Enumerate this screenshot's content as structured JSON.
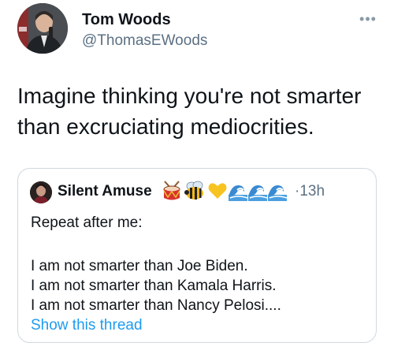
{
  "tweet": {
    "author": {
      "name": "Tom Woods",
      "handle": "@ThomasEWoods",
      "avatar_icon": "profile-photo"
    },
    "text": "Imagine thinking you're not smarter than excruciating mediocrities.",
    "more_icon": "ellipsis-icon",
    "quoted_tweet": {
      "author_name": "Silent Amuse",
      "author_emojis": [
        "drum",
        "bee",
        "yellow-heart",
        "wave",
        "wave",
        "wave"
      ],
      "separator": "·",
      "time": "13h",
      "body_lines": [
        "Repeat after me:",
        "I am not smarter than Joe Biden.",
        "I am not smarter than Kamala Harris.",
        "I am not smarter than Nancy Pelosi...."
      ],
      "show_thread": "Show this thread"
    }
  },
  "colors": {
    "text": "#0f1419",
    "secondary_text": "#5b7083",
    "link": "#1d9bf0",
    "border": "#cfd9de"
  }
}
